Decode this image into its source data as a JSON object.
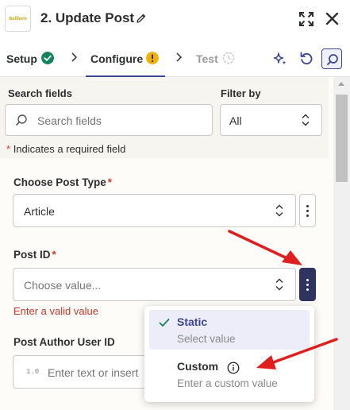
{
  "header": {
    "title": "2. Update Post",
    "logo_text": "Bullhorn"
  },
  "tabs": [
    {
      "label": "Setup",
      "status": "complete"
    },
    {
      "label": "Configure",
      "status": "warning"
    },
    {
      "label": "Test",
      "status": "pending"
    }
  ],
  "filters": {
    "search_label": "Search fields",
    "search_placeholder": "Search fields",
    "filter_label": "Filter by",
    "filter_value": "All",
    "required_note": "Indicates a required field",
    "required_star": "*"
  },
  "fields": {
    "post_type": {
      "label": "Choose Post Type",
      "star": "*",
      "value": "Article"
    },
    "post_id": {
      "label": "Post ID",
      "star": "*",
      "placeholder": "Choose value...",
      "error": "Enter a valid value"
    },
    "author": {
      "label": "Post Author User ID",
      "placeholder": "Enter text or insert",
      "type_badge": "1.0"
    }
  },
  "dropdown": {
    "options": [
      {
        "title": "Static",
        "description": "Select value",
        "selected": true
      },
      {
        "title": "Custom",
        "description": "Enter a custom value",
        "selected": false
      }
    ]
  },
  "colors": {
    "accent": "#3d4592",
    "success": "#12845b",
    "warning": "#f1b000",
    "error": "#c0392b",
    "annotation_arrow": "#e01e1e"
  }
}
